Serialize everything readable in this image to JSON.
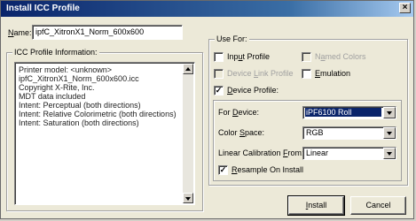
{
  "window": {
    "title": "Install ICC Profile",
    "close_glyph": "×"
  },
  "name_field": {
    "label_prefix": "N",
    "label_rest": "ame:",
    "value": "ipfC_XitronX1_Norm_600x600"
  },
  "icc_info": {
    "title": "ICC Profile Information:",
    "lines": [
      "Printer model: <unknown>",
      "ipfC_XitronX1_Norm_600x600.icc",
      "Copyright X-Rite, Inc.",
      "MDT data included",
      "Intent: Perceptual (both directions)",
      "Intent: Relative Colorimetric (both directions)",
      "Intent: Saturation (both directions)"
    ]
  },
  "use_for": {
    "title": "Use For:",
    "input_profile": {
      "pre": "Inp",
      "u": "u",
      "post": "t Profile",
      "checked": false
    },
    "named_colors": {
      "pre": "N",
      "u": "a",
      "post": "med Colors",
      "checked": false,
      "enabled": false
    },
    "device_link": {
      "pre": "Device ",
      "u": "L",
      "post": "ink Profile",
      "checked": false,
      "enabled": false
    },
    "emulation": {
      "pre": "",
      "u": "E",
      "post": "mulation",
      "checked": false
    },
    "device_profile": {
      "pre": "",
      "u": "D",
      "post": "evice Profile:",
      "checked": true,
      "check_glyph": "✓"
    }
  },
  "device": {
    "for_device": {
      "pre": "For ",
      "u": "D",
      "post": "evice:",
      "value": "iPF6100 Roll"
    },
    "color_space": {
      "pre": "Color ",
      "u": "S",
      "post": "pace:",
      "value": "RGB"
    },
    "linear_from": {
      "pre": "Linear Calibration ",
      "u": "F",
      "post": "rom:",
      "value": "Linear"
    },
    "resample": {
      "pre": "",
      "u": "R",
      "post": "esample On Install",
      "checked": true,
      "check_glyph": "✓"
    }
  },
  "buttons": {
    "install": {
      "pre": "",
      "u": "I",
      "post": "nstall"
    },
    "cancel": "Cancel"
  },
  "colors": {
    "title_bar": "#0a246a",
    "selection": "#0a246a"
  }
}
